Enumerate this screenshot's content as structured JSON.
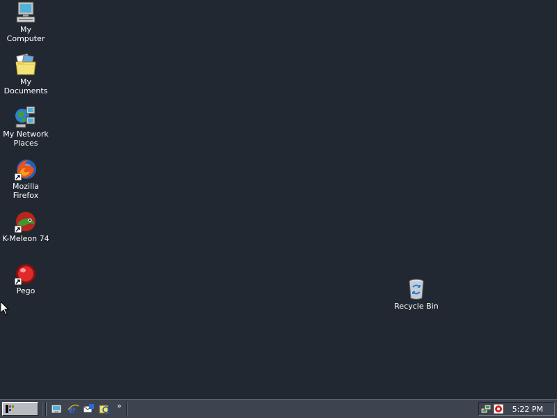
{
  "desktop": {
    "background_color": "#222831",
    "icons": [
      {
        "label": "My Computer",
        "icon": "computer-icon"
      },
      {
        "label": "My Documents",
        "icon": "folder-documents-icon"
      },
      {
        "label": "My Network Places",
        "icon": "network-places-icon"
      },
      {
        "label": "Mozilla Firefox",
        "icon": "firefox-icon",
        "shortcut": true
      },
      {
        "label": "K-Meleon 74",
        "icon": "kmeleon-icon",
        "shortcut": true
      },
      {
        "label": "Pego",
        "icon": "pego-icon",
        "shortcut": true
      },
      {
        "label": "Recycle Bin",
        "icon": "recycle-bin-icon"
      }
    ]
  },
  "taskbar": {
    "quick_launch": [
      {
        "icon": "show-desktop-icon"
      },
      {
        "icon": "internet-explorer-icon"
      },
      {
        "icon": "outlook-express-icon"
      },
      {
        "icon": "explorer-icon"
      }
    ],
    "quick_launch_more": "»",
    "tray": {
      "icons": [
        "network-tray-icon",
        "antivirus-tray-icon"
      ],
      "clock": "5:22 PM"
    }
  }
}
